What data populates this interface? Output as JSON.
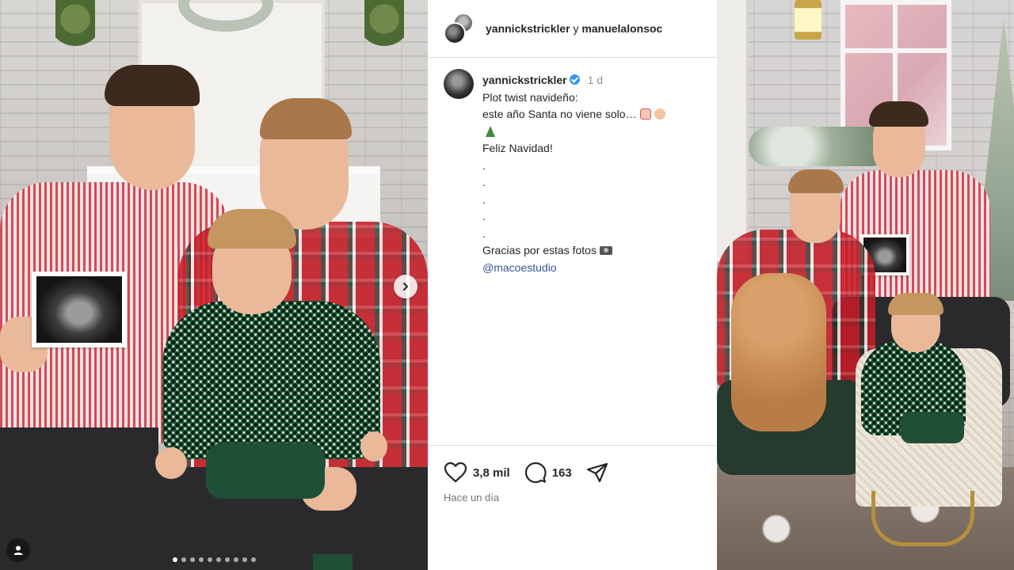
{
  "left_photo": {
    "carousel": {
      "count": 10,
      "active_index": 0
    }
  },
  "header": {
    "user1": "yannickstrickler",
    "joiner": "y",
    "user2": "manuelalonsoc"
  },
  "caption": {
    "username": "yannickstrickler",
    "time": "1 d",
    "lines": [
      "Plot twist navideño:",
      "este año Santa no viene solo…",
      "",
      "Feliz Navidad!",
      ".",
      ".",
      ".",
      ".",
      ".",
      "Gracias por estas fotos",
      "@macoestudio"
    ]
  },
  "actions": {
    "likes": "3,8 mil",
    "comments": "163",
    "posted": "Hace un día"
  },
  "icons": {
    "like": "heart-icon",
    "comment": "comment-icon",
    "share": "share-icon",
    "tag": "person-tag-icon",
    "next": "chevron-right-icon",
    "verified": "verified-badge-icon"
  },
  "colors": {
    "link": "#385898",
    "verified": "#3897f0",
    "text": "#262626",
    "muted": "#8e8e8e"
  }
}
